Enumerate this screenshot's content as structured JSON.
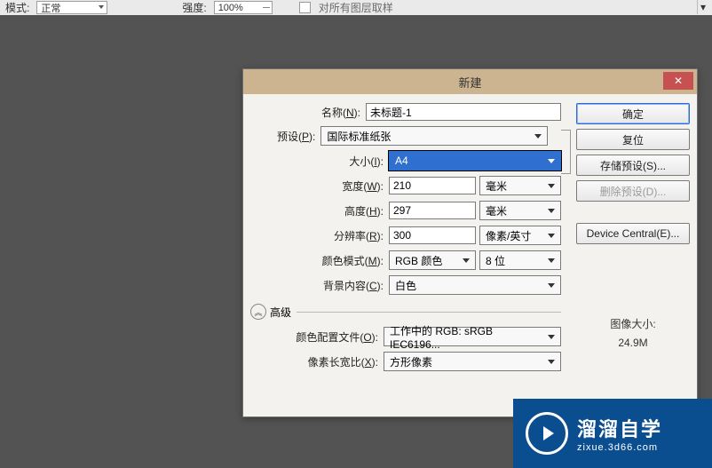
{
  "toolbar": {
    "mode_label": "模式:",
    "mode_value": "正常",
    "intensity_label": "强度:",
    "intensity_value": "100%",
    "checkbox_label": "对所有图层取样"
  },
  "dialog": {
    "title": "新建",
    "labels": {
      "name": "名称(",
      "name_key": "N",
      "preset": "预设(",
      "preset_key": "P",
      "size": "大小(",
      "size_key": "I",
      "width": "宽度(",
      "width_key": "W",
      "height": "高度(",
      "height_key": "H",
      "resolution": "分辨率(",
      "resolution_key": "R",
      "color_mode": "颜色模式(",
      "color_mode_key": "M",
      "bg": "背景内容(",
      "bg_key": "C",
      "advanced": "高级",
      "profile": "颜色配置文件(",
      "profile_key": "O",
      "aspect": "像素长宽比(",
      "aspect_key": "X",
      "close_paren": "):"
    },
    "values": {
      "name": "未标题-1",
      "preset": "国际标准纸张",
      "size": "A4",
      "width": "210",
      "width_unit": "毫米",
      "height": "297",
      "height_unit": "毫米",
      "resolution": "300",
      "resolution_unit": "像素/英寸",
      "color_mode": "RGB 颜色",
      "bit_depth": "8 位",
      "bg": "白色",
      "profile": "工作中的 RGB: sRGB IEC6196...",
      "aspect": "方形像素"
    },
    "buttons": {
      "ok": "确定",
      "reset": "复位",
      "save_preset": "存储预设(S)...",
      "delete_preset": "删除预设(D)...",
      "device_central": "Device Central(E)..."
    },
    "image_size_label": "图像大小:",
    "image_size_value": "24.9M"
  },
  "watermark": {
    "big": "溜溜自学",
    "small": "zixue.3d66.com"
  }
}
